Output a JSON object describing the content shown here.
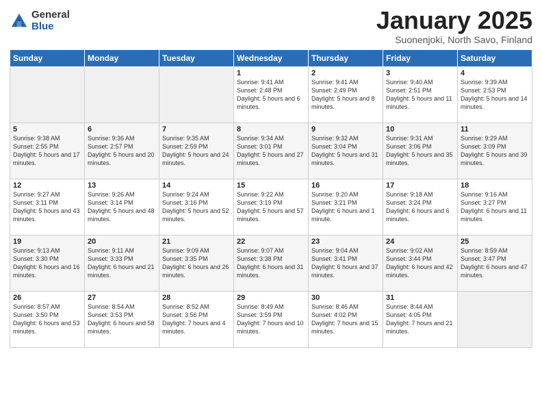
{
  "logo": {
    "general": "General",
    "blue": "Blue"
  },
  "title": "January 2025",
  "location": "Suonenjoki, North Savo, Finland",
  "headers": [
    "Sunday",
    "Monday",
    "Tuesday",
    "Wednesday",
    "Thursday",
    "Friday",
    "Saturday"
  ],
  "weeks": [
    [
      {
        "day": "",
        "info": ""
      },
      {
        "day": "",
        "info": ""
      },
      {
        "day": "",
        "info": ""
      },
      {
        "day": "1",
        "info": "Sunrise: 9:41 AM\nSunset: 2:48 PM\nDaylight: 5 hours and 6 minutes."
      },
      {
        "day": "2",
        "info": "Sunrise: 9:41 AM\nSunset: 2:49 PM\nDaylight: 5 hours and 8 minutes."
      },
      {
        "day": "3",
        "info": "Sunrise: 9:40 AM\nSunset: 2:51 PM\nDaylight: 5 hours and 11 minutes."
      },
      {
        "day": "4",
        "info": "Sunrise: 9:39 AM\nSunset: 2:53 PM\nDaylight: 5 hours and 14 minutes."
      }
    ],
    [
      {
        "day": "5",
        "info": "Sunrise: 9:38 AM\nSunset: 2:55 PM\nDaylight: 5 hours and 17 minutes."
      },
      {
        "day": "6",
        "info": "Sunrise: 9:36 AM\nSunset: 2:57 PM\nDaylight: 5 hours and 20 minutes."
      },
      {
        "day": "7",
        "info": "Sunrise: 9:35 AM\nSunset: 2:59 PM\nDaylight: 5 hours and 24 minutes."
      },
      {
        "day": "8",
        "info": "Sunrise: 9:34 AM\nSunset: 3:01 PM\nDaylight: 5 hours and 27 minutes."
      },
      {
        "day": "9",
        "info": "Sunrise: 9:32 AM\nSunset: 3:04 PM\nDaylight: 5 hours and 31 minutes."
      },
      {
        "day": "10",
        "info": "Sunrise: 9:31 AM\nSunset: 3:06 PM\nDaylight: 5 hours and 35 minutes."
      },
      {
        "day": "11",
        "info": "Sunrise: 9:29 AM\nSunset: 3:09 PM\nDaylight: 5 hours and 39 minutes."
      }
    ],
    [
      {
        "day": "12",
        "info": "Sunrise: 9:27 AM\nSunset: 3:11 PM\nDaylight: 5 hours and 43 minutes."
      },
      {
        "day": "13",
        "info": "Sunrise: 9:26 AM\nSunset: 3:14 PM\nDaylight: 5 hours and 48 minutes."
      },
      {
        "day": "14",
        "info": "Sunrise: 9:24 AM\nSunset: 3:16 PM\nDaylight: 5 hours and 52 minutes."
      },
      {
        "day": "15",
        "info": "Sunrise: 9:22 AM\nSunset: 3:19 PM\nDaylight: 5 hours and 57 minutes."
      },
      {
        "day": "16",
        "info": "Sunrise: 9:20 AM\nSunset: 3:21 PM\nDaylight: 6 hours and 1 minute."
      },
      {
        "day": "17",
        "info": "Sunrise: 9:18 AM\nSunset: 3:24 PM\nDaylight: 6 hours and 6 minutes."
      },
      {
        "day": "18",
        "info": "Sunrise: 9:16 AM\nSunset: 3:27 PM\nDaylight: 6 hours and 11 minutes."
      }
    ],
    [
      {
        "day": "19",
        "info": "Sunrise: 9:13 AM\nSunset: 3:30 PM\nDaylight: 6 hours and 16 minutes."
      },
      {
        "day": "20",
        "info": "Sunrise: 9:11 AM\nSunset: 3:33 PM\nDaylight: 6 hours and 21 minutes."
      },
      {
        "day": "21",
        "info": "Sunrise: 9:09 AM\nSunset: 3:35 PM\nDaylight: 6 hours and 26 minutes."
      },
      {
        "day": "22",
        "info": "Sunrise: 9:07 AM\nSunset: 3:38 PM\nDaylight: 6 hours and 31 minutes."
      },
      {
        "day": "23",
        "info": "Sunrise: 9:04 AM\nSunset: 3:41 PM\nDaylight: 6 hours and 37 minutes."
      },
      {
        "day": "24",
        "info": "Sunrise: 9:02 AM\nSunset: 3:44 PM\nDaylight: 6 hours and 42 minutes."
      },
      {
        "day": "25",
        "info": "Sunrise: 8:59 AM\nSunset: 3:47 PM\nDaylight: 6 hours and 47 minutes."
      }
    ],
    [
      {
        "day": "26",
        "info": "Sunrise: 8:57 AM\nSunset: 3:50 PM\nDaylight: 6 hours and 53 minutes."
      },
      {
        "day": "27",
        "info": "Sunrise: 8:54 AM\nSunset: 3:53 PM\nDaylight: 6 hours and 58 minutes."
      },
      {
        "day": "28",
        "info": "Sunrise: 8:52 AM\nSunset: 3:56 PM\nDaylight: 7 hours and 4 minutes."
      },
      {
        "day": "29",
        "info": "Sunrise: 8:49 AM\nSunset: 3:59 PM\nDaylight: 7 hours and 10 minutes."
      },
      {
        "day": "30",
        "info": "Sunrise: 8:46 AM\nSunset: 4:02 PM\nDaylight: 7 hours and 15 minutes."
      },
      {
        "day": "31",
        "info": "Sunrise: 8:44 AM\nSunset: 4:05 PM\nDaylight: 7 hours and 21 minutes."
      },
      {
        "day": "",
        "info": ""
      }
    ]
  ]
}
